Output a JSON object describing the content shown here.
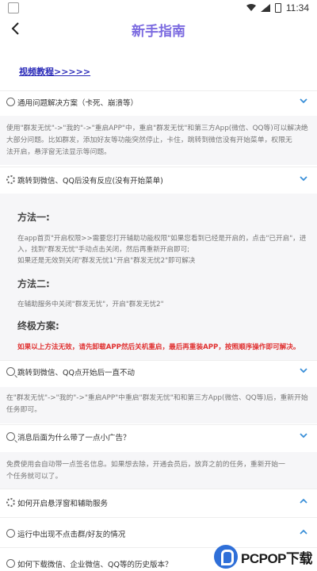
{
  "status_bar": {
    "time": "11:34"
  },
  "header": {
    "title": "新手指南"
  },
  "video_link": "视频教程>>>>>",
  "sections": [
    {
      "title": "通用问题解决方案（卡死、崩溃等）",
      "icon": "info-icon",
      "expanded": true
    },
    {
      "title": "跳转到微信、QQ后没有反应(没有开始菜单)",
      "icon": "gear-icon",
      "expanded": true
    },
    {
      "title": "跳转到微信、QQ点开始后一直不动",
      "icon": "search-icon",
      "expanded": true
    },
    {
      "title": "消息后面为什么带了一点小广告？",
      "icon": "search-icon",
      "expanded": true
    },
    {
      "title": "如何开启悬浮窗和辅助服务",
      "icon": "gear-icon",
      "expanded": false
    },
    {
      "title": "运行中出现不点击群/好友的情况",
      "icon": "info-icon",
      "expanded": false
    },
    {
      "title": "如何下载微信、企业微信、QQ等的历史版本？",
      "icon": "info-icon",
      "expanded": false
    }
  ],
  "section1_body": [
    "使用\"群发无忧\"->\"我的\"->\"重启APP\"中，重启\"群发无忧\"和第三方App(微信、QQ等)可以解决绝",
    "大部分问题。比如群发，添加好友等功能突然停止，卡住，跳转到微信没有开始菜单，权限无",
    "法开启，悬浮窗无法显示等问题。"
  ],
  "method1": {
    "heading": "方法一:",
    "lines": [
      "在app首页\"开启权限>>需要您打开辅助功能权限\"如果您看到已经是开启的，点击\"已开启\"，进",
      "入，找到\"群发无忧\"手动点击关闭，然后再重新开启即可;",
      "如果还是无效到关闭\"群发无忧1\"开启\"群发无忧2\"即可解决"
    ]
  },
  "method2": {
    "heading": "方法二:",
    "lines": [
      "在辅助服务中关闭\"群发无忧\"，开启\"群发无忧2\""
    ]
  },
  "method_final": {
    "heading": "终极方案:",
    "warning": "如果以上方法无效，请先卸载APP然后关机重启，最后再重装APP，按照顺序操作即可解决。"
  },
  "section3_body": [
    "在\"群发无忧\"->\"我的\"->\"重启APP\"中重启\"群发无忧\"和和第三方App(微信、QQ等)后，重新开始",
    "任务即可。"
  ],
  "section4_body": [
    "免费使用会自动带一点签名信息。如果想去除，开通会员后，放弃之前的任务，重新开始一",
    "个任务就可以了。"
  ],
  "watermark": {
    "text": "PCPOP下载"
  },
  "colors": {
    "title": "#7c6be0",
    "link": "#2a2ab8",
    "warning": "#e03030",
    "chevron": "#3a8fd8"
  }
}
